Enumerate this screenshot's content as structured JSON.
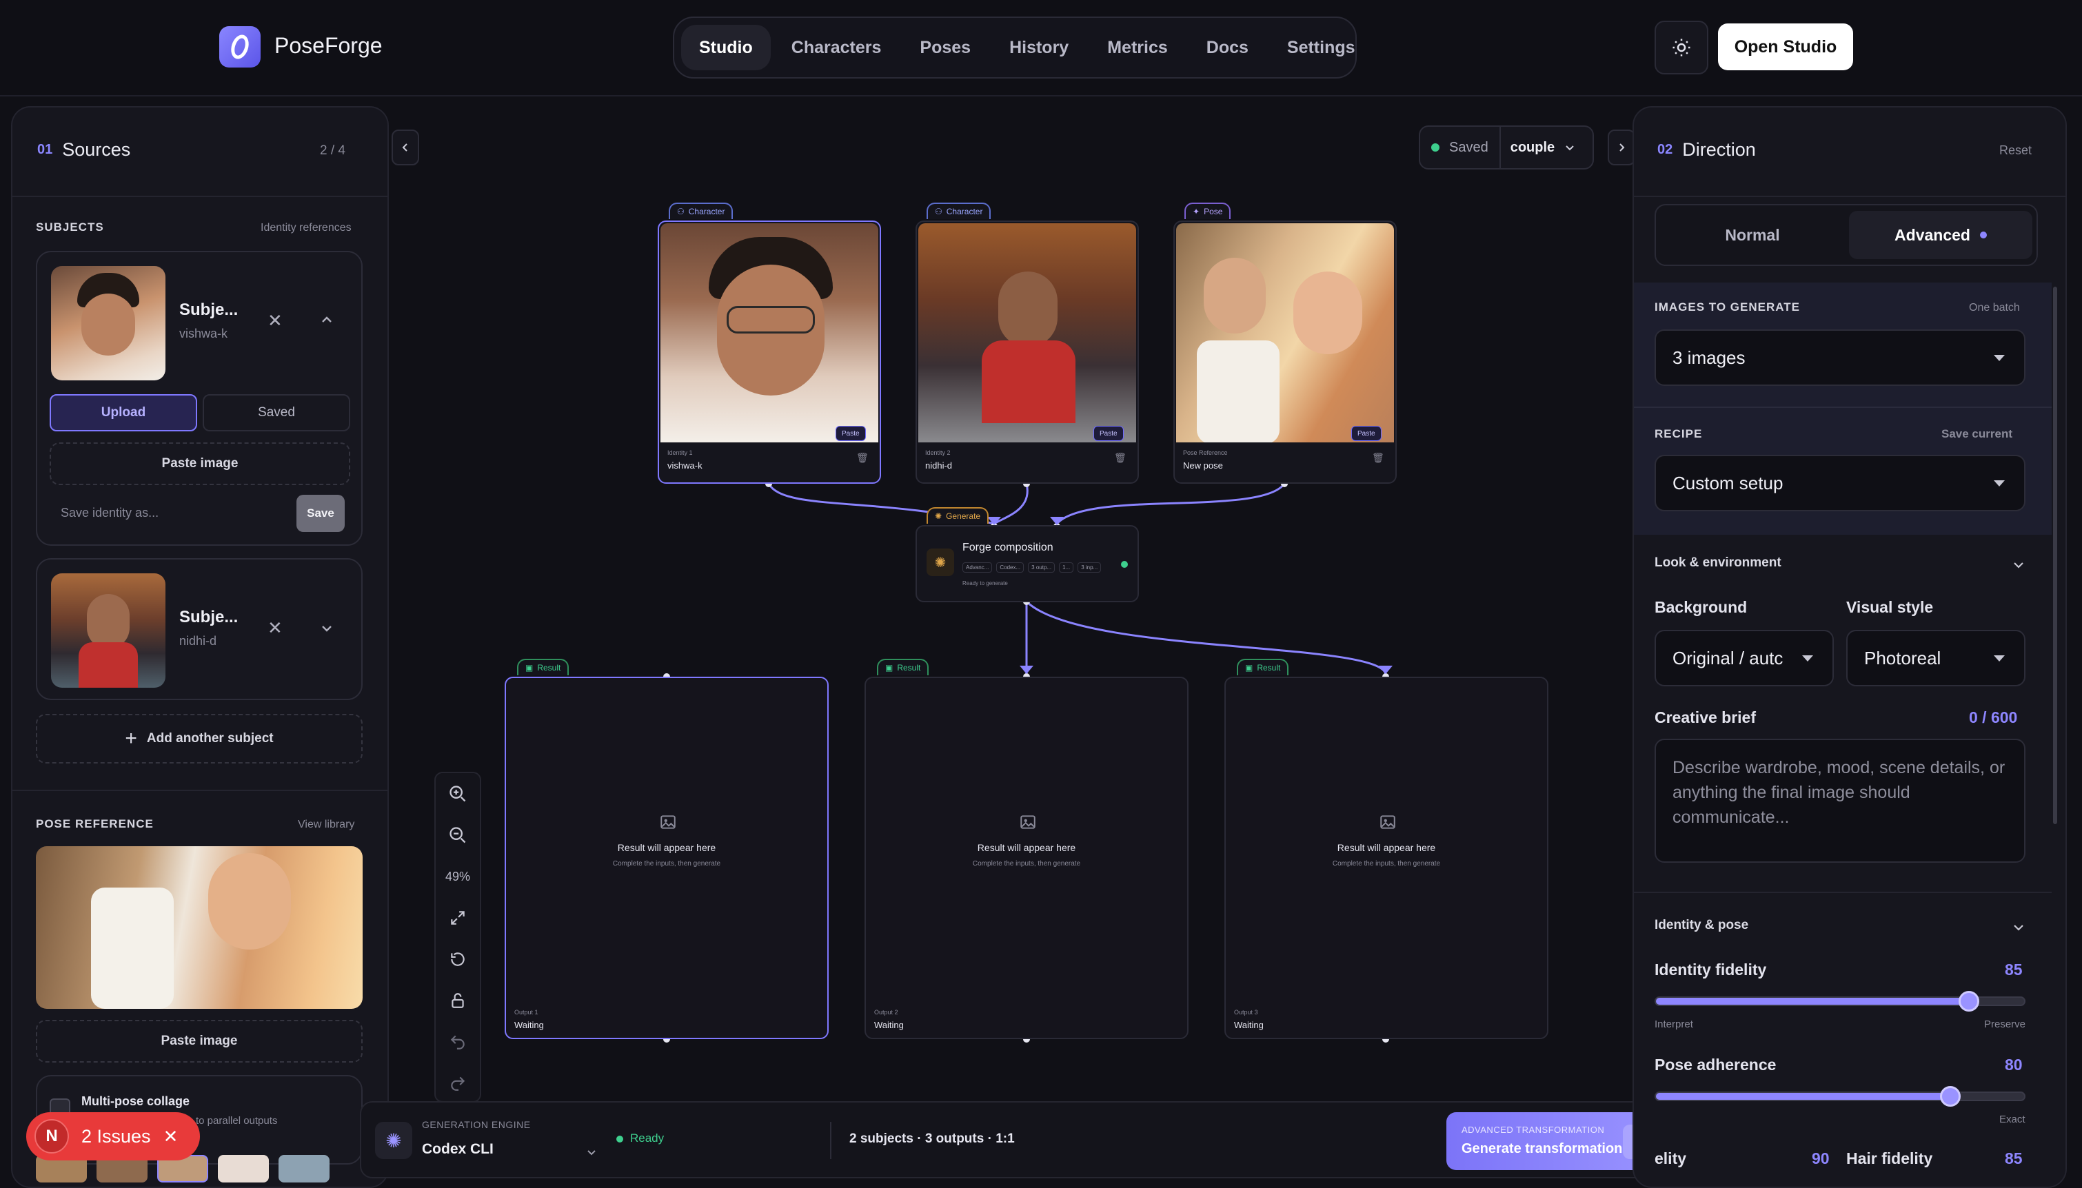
{
  "app": {
    "brand": "PoseForge"
  },
  "nav": {
    "items": [
      "Studio",
      "Characters",
      "Poses",
      "History",
      "Metrics",
      "Docs",
      "Settings"
    ],
    "active": "Studio"
  },
  "header": {
    "open_studio": "Open Studio",
    "theme_icon": "sun-icon"
  },
  "sources": {
    "num": "01",
    "title": "Sources",
    "count": "2 / 4",
    "subjects_heading": "SUBJECTS",
    "subjects_link": "Identity references",
    "subject1": {
      "name": "Subje...",
      "handle": "vishwa-k"
    },
    "subject2": {
      "name": "Subje...",
      "handle": "nidhi-d"
    },
    "tab_upload": "Upload",
    "tab_saved": "Saved",
    "paste_image": "Paste image",
    "save_identity_placeholder": "Save identity as...",
    "save_btn": "Save",
    "add_subject": "Add another subject",
    "pose_heading": "POSE REFERENCE",
    "pose_link": "View library",
    "pose_paste": "Paste image",
    "collage_title": "Multi-pose collage",
    "collage_sub": "to parallel outputs"
  },
  "issues": {
    "avatar": "N",
    "label": "2 Issues"
  },
  "canvas": {
    "status": "Saved",
    "mode": "couple",
    "inputs": [
      {
        "tag": "Character",
        "sub": "Identity 1",
        "name": "vishwa-k",
        "paste": "Paste"
      },
      {
        "tag": "Character",
        "sub": "Identity 2",
        "name": "nidhi-d",
        "paste": "Paste"
      },
      {
        "tag": "Pose",
        "sub": "Pose Reference",
        "name": "New pose",
        "paste": "Paste"
      }
    ],
    "generate": {
      "tag": "Generate",
      "title": "Forge composition",
      "chips": [
        "Advanc...",
        "Codex...",
        "3 outp...",
        "1...",
        "3 inp..."
      ],
      "status": "Ready to generate"
    },
    "results": [
      {
        "tag": "Result",
        "title": "Result will appear here",
        "sub": "Complete the inputs, then generate",
        "out": "Output 1",
        "state": "Waiting"
      },
      {
        "tag": "Result",
        "title": "Result will appear here",
        "sub": "Complete the inputs, then generate",
        "out": "Output 2",
        "state": "Waiting"
      },
      {
        "tag": "Result",
        "title": "Result will appear here",
        "sub": "Complete the inputs, then generate",
        "out": "Output 3",
        "state": "Waiting"
      }
    ],
    "zoom": "49%"
  },
  "bottom": {
    "engine_label": "GENERATION ENGINE",
    "engine_value": "Codex CLI",
    "engine_status": "Ready",
    "summary": "2 subjects · 3 outputs · 1:1",
    "gen_kicker": "ADVANCED TRANSFORMATION",
    "gen_label": "Generate transformation"
  },
  "direction": {
    "num": "02",
    "title": "Direction",
    "reset": "Reset",
    "mode_normal": "Normal",
    "mode_advanced": "Advanced",
    "images_heading": "IMAGES TO GENERATE",
    "images_hint": "One batch",
    "images_value": "3 images",
    "recipe_heading": "RECIPE",
    "recipe_link": "Save current",
    "recipe_value": "Custom setup",
    "look_section": "Look & environment",
    "background_label": "Background",
    "background_value": "Original / autc",
    "style_label": "Visual style",
    "style_value": "Photoreal",
    "brief_label": "Creative brief",
    "brief_count": "0 / 600",
    "brief_placeholder": "Describe wardrobe, mood, scene details, or anything the final image should communicate...",
    "identity_section": "Identity & pose",
    "identity_fidelity": {
      "label": "Identity fidelity",
      "value": 85,
      "min_label": "Interpret",
      "max_label": "Preserve"
    },
    "pose_adherence": {
      "label": "Pose adherence",
      "value": 80,
      "max_label": "Exact"
    },
    "face_fidelity": {
      "label": "elity",
      "value": "90"
    },
    "hair_fidelity": {
      "label": "Hair fidelity",
      "value": "85"
    }
  },
  "colors": {
    "accent": "#8e86ff",
    "success": "#3ecf8e",
    "danger": "#e83a3a",
    "warning": "#e0a64a"
  }
}
